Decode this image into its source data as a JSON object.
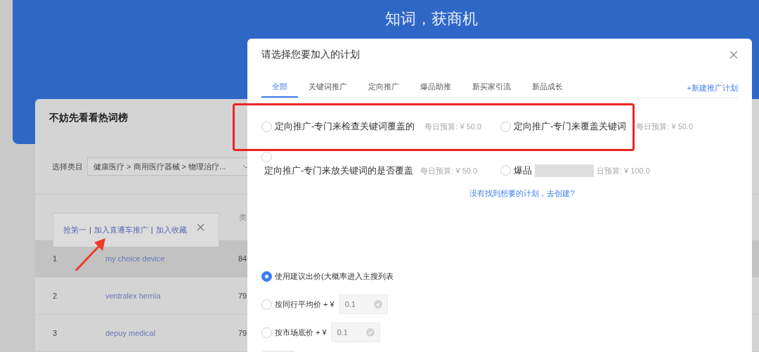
{
  "banner": {
    "title": "知词，获商机"
  },
  "hot_words": {
    "title": "不妨先看看热词榜",
    "category_label": "选择类目",
    "category_value": "健康医疗 > 商用医疗器械 > 物理治疗...",
    "column_header": "类",
    "tooltip": {
      "links": [
        "抢第一",
        "加入直通车推广",
        "加入收藏"
      ],
      "separators": [
        "|",
        "|"
      ]
    },
    "rows": [
      {
        "rank": "1",
        "keyword": "my choice device",
        "column_3": "84",
        "selected": true
      },
      {
        "rank": "2",
        "keyword": "ventralex hernia",
        "column_3": "79",
        "selected": false
      },
      {
        "rank": "3",
        "keyword": "depuy medical",
        "column_3": "79",
        "selected": false
      }
    ]
  },
  "dialog": {
    "title": "请选择您要加入的计划",
    "tabs": [
      {
        "label": "全部",
        "selected": true
      },
      {
        "label": "关键词推广",
        "selected": false
      },
      {
        "label": "定向推广",
        "selected": false
      },
      {
        "label": "爆品助推",
        "selected": false
      },
      {
        "label": "新买家引流",
        "selected": false
      },
      {
        "label": "新品成长",
        "selected": false
      }
    ],
    "new_plan_link": "+新建推广计划",
    "plans": [
      {
        "name": "定向推广-专门来检查关键词覆盖的",
        "budget": "每日预算: ¥ 50.0",
        "selected": false,
        "kind": "inline"
      },
      {
        "name": "定向推广-专门来覆盖关键词",
        "budget": "每日预算: ¥ 50.0",
        "selected": false,
        "kind": "inline"
      },
      {
        "name": "定向推广-专门来放关键词的是否覆盖",
        "budget": "每日预算: ¥ 50.0",
        "selected": false,
        "kind": "stacked"
      },
      {
        "name": "爆品",
        "budget": "日预算: ¥ 100.0",
        "selected": false,
        "kind": "redacted"
      }
    ],
    "create_link": "没有找到想要的计划，去创建?",
    "bid_options": [
      {
        "label": "使用建议出价(大概率进入主搜列表",
        "selected": true,
        "kind": "plain"
      },
      {
        "label": "按同行平均价 + ¥",
        "selected": false,
        "kind": "input",
        "placeholder": "0.1"
      },
      {
        "label": "按市场底价 + ¥",
        "selected": false,
        "kind": "input",
        "placeholder": "0.1"
      }
    ]
  }
}
